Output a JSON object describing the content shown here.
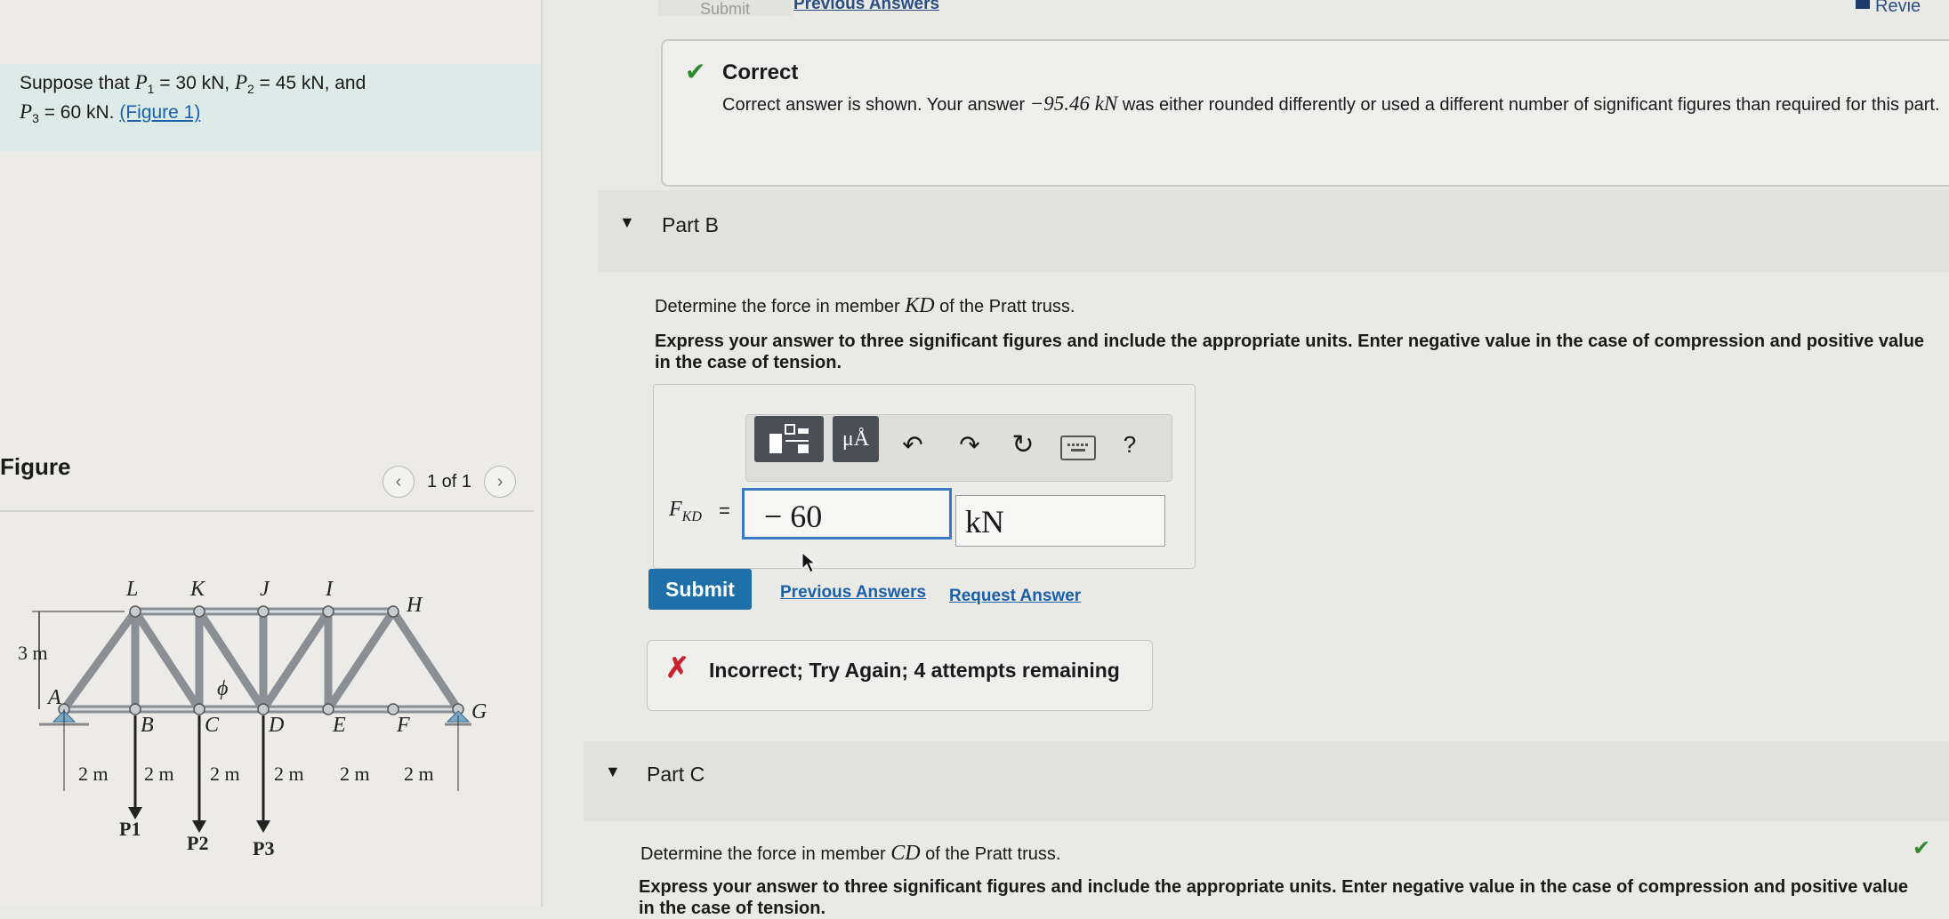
{
  "header": {
    "submit_faded": "Submit",
    "previous_answers": "Previous Answers",
    "review": "Revie"
  },
  "problem": {
    "intro": "Suppose that ",
    "p1": "P",
    "p1_sub": "1",
    "p1_val": " = 30 kN, ",
    "p2": "P",
    "p2_sub": "2",
    "p2_val": " = 45 kN, and",
    "p3": "P",
    "p3_sub": "3",
    "p3_val": " = 60 kN. ",
    "figure_link": "(Figure 1)"
  },
  "figure_panel": {
    "label": "Figure",
    "pager_text": "1 of 1",
    "nodes_top": [
      "L",
      "K",
      "J",
      "I",
      "H"
    ],
    "nodes_bottom": [
      "A",
      "B",
      "C",
      "D",
      "E",
      "F",
      "G"
    ],
    "height_label": "3 m",
    "span_label": "2 m",
    "angle_label": "ϕ",
    "loads": [
      "P1",
      "P2",
      "P3"
    ]
  },
  "part_a_feedback": {
    "title": "Correct",
    "text_before": "Correct answer is shown. Your answer ",
    "answer": "−95.46 kN",
    "text_after": " was either rounded differently or used a different number of significant figures than required for this part."
  },
  "part_b": {
    "title": "Part B",
    "question_before": "Determine the force in member ",
    "member": "KD",
    "question_after": " of the Pratt truss.",
    "instructions": "Express your answer to three significant figures and include the appropriate units. Enter negative value in the case of compression and positive value in the case of tension.",
    "var_label": "F",
    "var_sub": "KD",
    "equals": "=",
    "value": "− 60",
    "unit": "kN",
    "toolbar": {
      "templates_icon": "templates-icon",
      "units_label": "μÅ",
      "help_label": "?"
    },
    "submit_label": "Submit",
    "previous_answers_label": "Previous Answers",
    "request_answer_label": "Request Answer",
    "feedback": "Incorrect; Try Again; 4 attempts remaining"
  },
  "part_c": {
    "title": "Part C",
    "question_before": "Determine the force in member ",
    "member": "CD",
    "question_after": " of the Pratt truss.",
    "instructions": "Express your answer to three significant figures and include the appropriate units. Enter negative value in the case of compression and positive value in the case of tension."
  },
  "colors": {
    "accent_blue": "#1f6fa8",
    "correct_green": "#2e8a2e",
    "incorrect_red": "#c8232c",
    "problem_bg": "#dcebe7"
  }
}
